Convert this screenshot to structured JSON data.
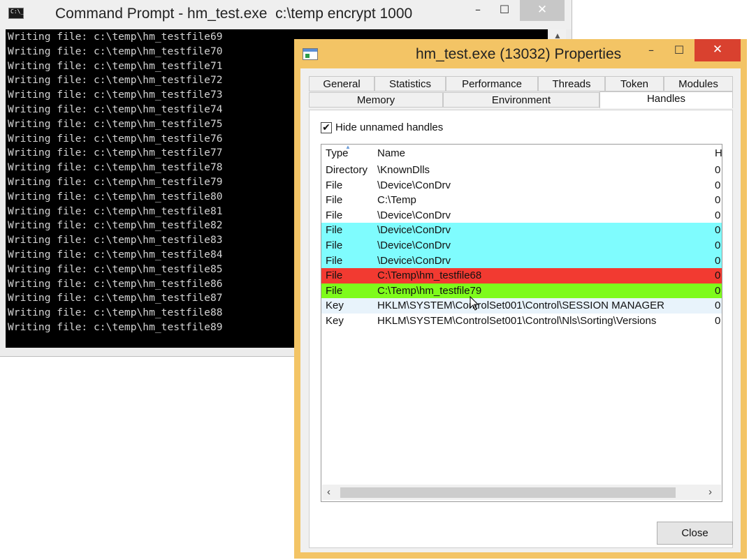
{
  "cmd": {
    "title": "Command Prompt - hm_test.exe  c:\\temp encrypt 1000",
    "icon_text": "C:\\_",
    "buttons": {
      "minimize": "–",
      "maximize": "☐",
      "close": "✕"
    },
    "lines": [
      "Writing file: c:\\temp\\hm_testfile69",
      "Writing file: c:\\temp\\hm_testfile70",
      "Writing file: c:\\temp\\hm_testfile71",
      "Writing file: c:\\temp\\hm_testfile72",
      "Writing file: c:\\temp\\hm_testfile73",
      "Writing file: c:\\temp\\hm_testfile74",
      "Writing file: c:\\temp\\hm_testfile75",
      "Writing file: c:\\temp\\hm_testfile76",
      "Writing file: c:\\temp\\hm_testfile77",
      "Writing file: c:\\temp\\hm_testfile78",
      "Writing file: c:\\temp\\hm_testfile79",
      "Writing file: c:\\temp\\hm_testfile80",
      "Writing file: c:\\temp\\hm_testfile81",
      "Writing file: c:\\temp\\hm_testfile82",
      "Writing file: c:\\temp\\hm_testfile83",
      "Writing file: c:\\temp\\hm_testfile84",
      "Writing file: c:\\temp\\hm_testfile85",
      "Writing file: c:\\temp\\hm_testfile86",
      "Writing file: c:\\temp\\hm_testfile87",
      "Writing file: c:\\temp\\hm_testfile88",
      "Writing file: c:\\temp\\hm_testfile89"
    ]
  },
  "props": {
    "title": "hm_test.exe (13032) Properties",
    "buttons": {
      "minimize": "–",
      "maximize": "☐",
      "close": "✕"
    },
    "tabs_row1": [
      "General",
      "Statistics",
      "Performance",
      "Threads",
      "Token",
      "Modules"
    ],
    "tabs_row2": [
      "Memory",
      "Environment",
      "Handles"
    ],
    "active_tab": "Handles",
    "hide_unnamed": {
      "checked": true,
      "check_glyph": "✔",
      "label": "Hide unnamed handles"
    },
    "columns": {
      "type": "Type",
      "name": "Name",
      "handle": "H"
    },
    "rows": [
      {
        "type": "Directory",
        "name": "\\KnownDlls",
        "h": "0",
        "color": "#ffffff"
      },
      {
        "type": "File",
        "name": "\\Device\\ConDrv",
        "h": "0",
        "color": "#ffffff"
      },
      {
        "type": "File",
        "name": "C:\\Temp",
        "h": "0",
        "color": "#ffffff"
      },
      {
        "type": "File",
        "name": "\\Device\\ConDrv",
        "h": "0",
        "color": "#ffffff"
      },
      {
        "type": "File",
        "name": "\\Device\\ConDrv",
        "h": "0",
        "color": "#7ffcfe"
      },
      {
        "type": "File",
        "name": "\\Device\\ConDrv",
        "h": "0",
        "color": "#7ffcfe"
      },
      {
        "type": "File",
        "name": "\\Device\\ConDrv",
        "h": "0",
        "color": "#7ffcfe"
      },
      {
        "type": "File",
        "name": "C:\\Temp\\hm_testfile68",
        "h": "0",
        "color": "#f23a31"
      },
      {
        "type": "File",
        "name": "C:\\Temp\\hm_testfile79",
        "h": "0",
        "color": "#7efb1b"
      },
      {
        "type": "Key",
        "name": "HKLM\\SYSTEM\\ControlSet001\\Control\\SESSION MANAGER",
        "h": "0",
        "color": "#e8f3fb"
      },
      {
        "type": "Key",
        "name": "HKLM\\SYSTEM\\ControlSet001\\Control\\Nls\\Sorting\\Versions",
        "h": "0",
        "color": "#ffffff"
      }
    ],
    "scroll_left": "‹",
    "scroll_right": "›",
    "close_label": "Close"
  }
}
